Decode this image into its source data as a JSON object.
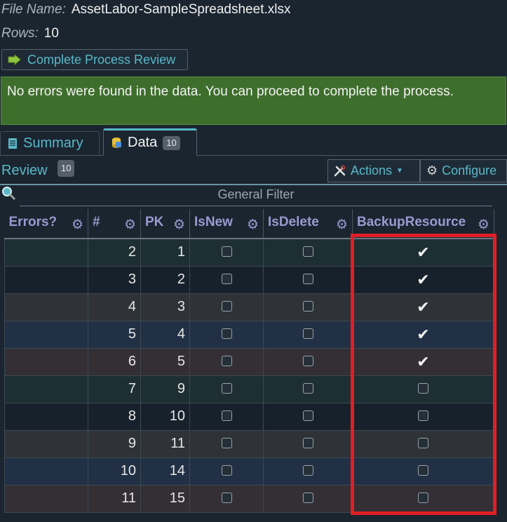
{
  "file": {
    "label": "File Name:",
    "value": "AssetLabor-SampleSpreadsheet.xlsx"
  },
  "rows": {
    "label": "Rows:",
    "value": "10"
  },
  "complete_button": {
    "label": "Complete Process Review",
    "icon": "arrow-icon"
  },
  "status_message": "No errors were found in the data. You can proceed to complete the process.",
  "tabs": [
    {
      "label": "Summary",
      "icon": "document-icon",
      "active": false
    },
    {
      "label": "Data",
      "icon": "database-icon",
      "badge": "10",
      "active": true
    }
  ],
  "review": {
    "label": "Review",
    "badge": "10"
  },
  "toolbar": {
    "actions_label": "Actions",
    "configure_label": "Configure"
  },
  "filter": {
    "label": "General Filter"
  },
  "table": {
    "columns": [
      "Errors?",
      "#",
      "PK",
      "IsNew",
      "IsDelete",
      "BackupResource"
    ],
    "rows": [
      {
        "errors": "",
        "num": "2",
        "pk": "1",
        "isnew": false,
        "isdelete": false,
        "backup": true
      },
      {
        "errors": "",
        "num": "3",
        "pk": "2",
        "isnew": false,
        "isdelete": false,
        "backup": true
      },
      {
        "errors": "",
        "num": "4",
        "pk": "3",
        "isnew": false,
        "isdelete": false,
        "backup": true
      },
      {
        "errors": "",
        "num": "5",
        "pk": "4",
        "isnew": false,
        "isdelete": false,
        "backup": true
      },
      {
        "errors": "",
        "num": "6",
        "pk": "5",
        "isnew": false,
        "isdelete": false,
        "backup": true
      },
      {
        "errors": "",
        "num": "7",
        "pk": "9",
        "isnew": false,
        "isdelete": false,
        "backup": false
      },
      {
        "errors": "",
        "num": "8",
        "pk": "10",
        "isnew": false,
        "isdelete": false,
        "backup": false
      },
      {
        "errors": "",
        "num": "9",
        "pk": "11",
        "isnew": false,
        "isdelete": false,
        "backup": false
      },
      {
        "errors": "",
        "num": "10",
        "pk": "14",
        "isnew": false,
        "isdelete": false,
        "backup": false
      },
      {
        "errors": "",
        "num": "11",
        "pk": "15",
        "isnew": false,
        "isdelete": false,
        "backup": false
      }
    ]
  },
  "colors": {
    "accent": "#5ab8c8",
    "success_bg": "#3e6e2c",
    "highlight": "#e01e25",
    "header_text": "#9a9ad0"
  }
}
